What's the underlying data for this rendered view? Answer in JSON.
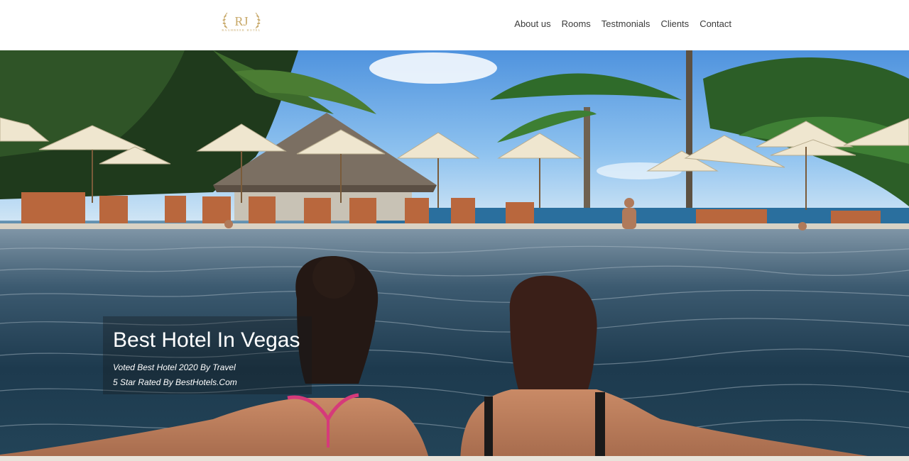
{
  "header": {
    "logo": {
      "monogram": "RJ",
      "name": "RAGHBEER HOTEL",
      "color": "#c8a96a"
    },
    "nav": [
      {
        "label": "About us"
      },
      {
        "label": "Rooms"
      },
      {
        "label": "Testmonials"
      },
      {
        "label": "Clients"
      },
      {
        "label": "Contact"
      }
    ]
  },
  "hero": {
    "image": "resort infinity pool with palm trees, umbrellas and two women in the water",
    "title": "Best Hotel In Vegas",
    "subtitle_lines": [
      "Voted Best Hotel 2020 By Travel",
      "5 Star Rated By BestHotels.Com"
    ]
  }
}
